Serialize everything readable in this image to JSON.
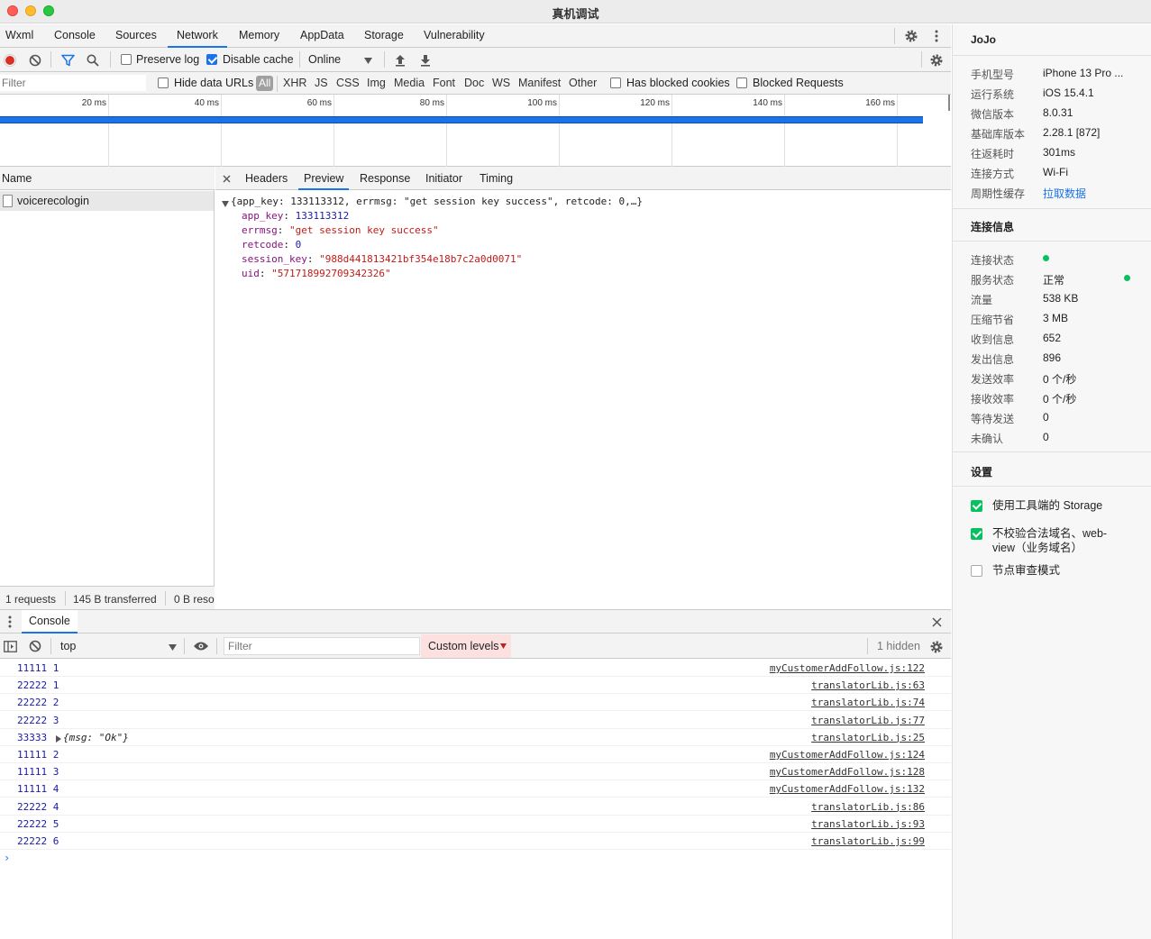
{
  "window": {
    "title": "真机调试"
  },
  "tabs": [
    "Wxml",
    "Console",
    "Sources",
    "Network",
    "Memory",
    "AppData",
    "Storage",
    "Vulnerability"
  ],
  "active_tab": "Network",
  "network": {
    "toolbar": {
      "preserve_log": {
        "label": "Preserve log",
        "checked": false
      },
      "disable_cache": {
        "label": "Disable cache",
        "checked": true
      },
      "throttle": "Online"
    },
    "filter_bar": {
      "placeholder": "Filter",
      "hide_data_urls": {
        "label": "Hide data URLs",
        "checked": false
      },
      "types": [
        "All",
        "XHR",
        "JS",
        "CSS",
        "Img",
        "Media",
        "Font",
        "Doc",
        "WS",
        "Manifest",
        "Other"
      ],
      "active_type": "All",
      "has_blocked_cookies": {
        "label": "Has blocked cookies",
        "checked": false
      },
      "blocked_requests": {
        "label": "Blocked Requests",
        "checked": false
      }
    },
    "timeline_ticks": [
      "20 ms",
      "40 ms",
      "60 ms",
      "80 ms",
      "100 ms",
      "120 ms",
      "140 ms",
      "160 ms"
    ],
    "request_list": {
      "header": "Name",
      "rows": [
        {
          "name": "voicerecologin"
        }
      ],
      "status": {
        "requests": "1 requests",
        "transferred": "145 B transferred",
        "resources": "0 B reso"
      }
    },
    "detail": {
      "tabs": [
        "Headers",
        "Preview",
        "Response",
        "Initiator",
        "Timing"
      ],
      "active_tab": "Preview",
      "summary": "{app_key: 133113312, errmsg: \"get session key success\", retcode: 0,…}",
      "fields": [
        {
          "key": "app_key",
          "value": "133113312",
          "type": "num"
        },
        {
          "key": "errmsg",
          "value": "\"get session key success\"",
          "type": "str"
        },
        {
          "key": "retcode",
          "value": "0",
          "type": "num"
        },
        {
          "key": "session_key",
          "value": "\"988d441813421bf354e18b7c2a0d0071\"",
          "type": "str"
        },
        {
          "key": "uid",
          "value": "\"571718992709342326\"",
          "type": "str"
        }
      ]
    }
  },
  "console": {
    "drawer_tab": "Console",
    "context": "top",
    "filter_placeholder": "Filter",
    "levels": "Custom levels",
    "hidden": "1 hidden",
    "logs": [
      {
        "msg": "11111 1",
        "src": "myCustomerAddFollow.js:122"
      },
      {
        "msg": "22222 1",
        "src": "translatorLib.js:63"
      },
      {
        "msg": "22222 2",
        "src": "translatorLib.js:74"
      },
      {
        "msg": "22222 3",
        "src": "translatorLib.js:77"
      },
      {
        "msg": "33333",
        "obj": "{msg: \"Ok\"}",
        "src": "translatorLib.js:25"
      },
      {
        "msg": "11111 2",
        "src": "myCustomerAddFollow.js:124"
      },
      {
        "msg": "11111 3",
        "src": "myCustomerAddFollow.js:128"
      },
      {
        "msg": "11111 4",
        "src": "myCustomerAddFollow.js:132"
      },
      {
        "msg": "22222 4",
        "src": "translatorLib.js:86"
      },
      {
        "msg": "22222 5",
        "src": "translatorLib.js:93"
      },
      {
        "msg": "22222 6",
        "src": "translatorLib.js:99"
      }
    ]
  },
  "side_panel": {
    "app_name": "JoJo",
    "device": [
      {
        "label": "手机型号",
        "value": "iPhone 13 Pro ..."
      },
      {
        "label": "运行系统",
        "value": "iOS 15.4.1"
      },
      {
        "label": "微信版本",
        "value": "8.0.31"
      },
      {
        "label": "基础库版本",
        "value": "2.28.1 [872]"
      },
      {
        "label": "往返耗时",
        "value": "301ms"
      },
      {
        "label": "连接方式",
        "value": "Wi-Fi"
      },
      {
        "label": "周期性缓存",
        "value": "拉取数据",
        "link": true
      }
    ],
    "connection_title": "连接信息",
    "connection": [
      {
        "label": "连接状态",
        "value": ""
      },
      {
        "label": "服务状态",
        "value": "正常"
      },
      {
        "label": "流量",
        "value": "538 KB"
      },
      {
        "label": "压缩节省",
        "value": "3 MB"
      },
      {
        "label": "收到信息",
        "value": "652"
      },
      {
        "label": "发出信息",
        "value": "896"
      },
      {
        "label": "发送效率",
        "value": "0 个/秒"
      },
      {
        "label": "接收效率",
        "value": "0 个/秒"
      },
      {
        "label": "等待发送",
        "value": "0"
      },
      {
        "label": "未确认",
        "value": "0"
      }
    ],
    "settings_title": "设置",
    "settings": [
      {
        "label": "使用工具端的 Storage",
        "checked": true
      },
      {
        "label": "不校验合法域名、web-view（业务域名）",
        "checked": true
      },
      {
        "label": "节点审查模式",
        "checked": false
      }
    ],
    "status_color": "#07c160"
  },
  "colors": {
    "accent": "#1a73e8",
    "record": "#d93025",
    "link": "#1a73e8"
  }
}
